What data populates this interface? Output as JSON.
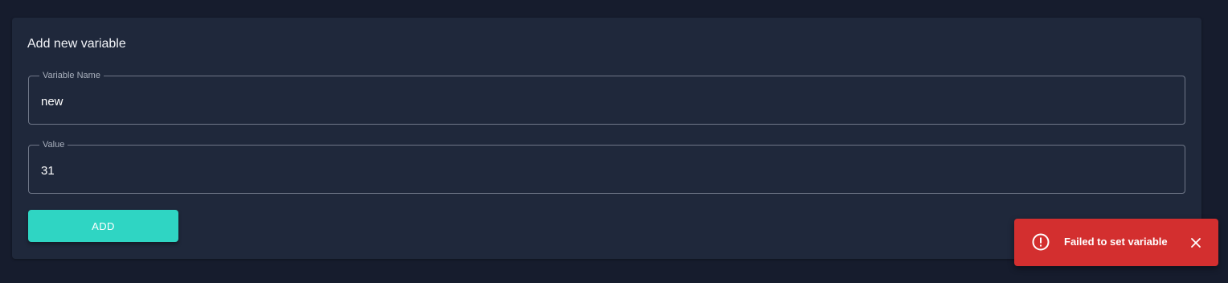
{
  "card": {
    "title": "Add new variable"
  },
  "fields": {
    "variable_name": {
      "label": "Variable Name",
      "value": "new"
    },
    "value": {
      "label": "Value",
      "value": "31"
    }
  },
  "buttons": {
    "add_label": "ADD"
  },
  "toast": {
    "message": "Failed to set variable",
    "icon": "error-outline-icon",
    "close_icon": "close-icon",
    "color": "#d32f2f"
  },
  "colors": {
    "background": "#161c2d",
    "card": "#1f283b",
    "accent": "#2fd5c3"
  }
}
